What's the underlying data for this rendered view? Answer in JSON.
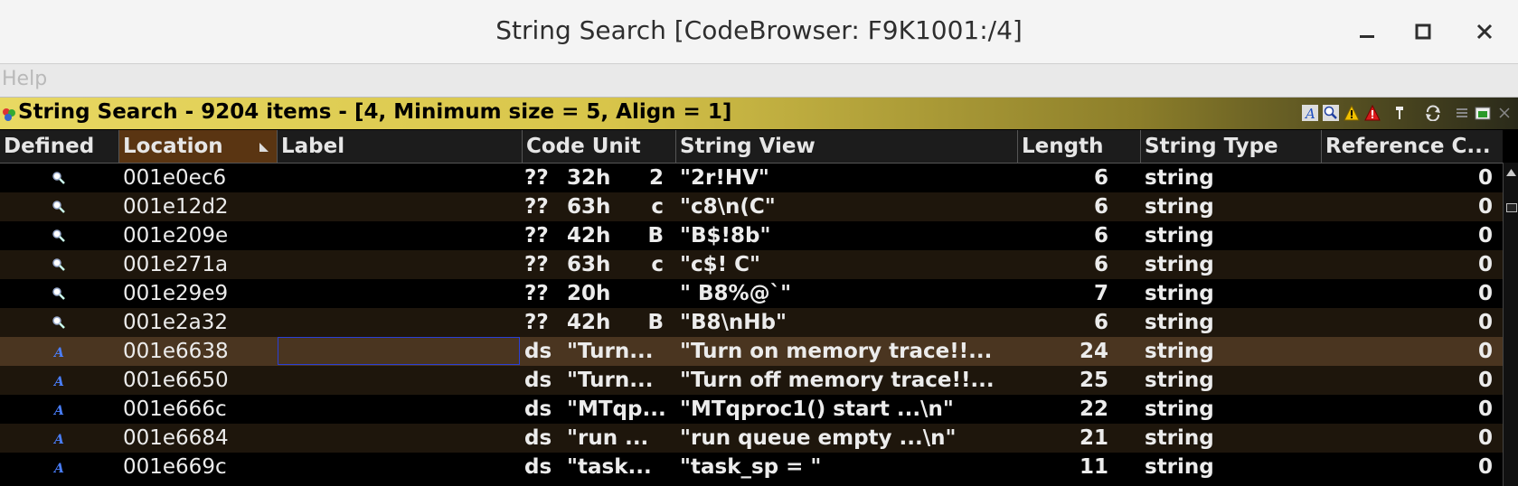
{
  "window": {
    "title": "String Search [CodeBrowser: F9K1001:/4]"
  },
  "menu": {
    "help": "Help"
  },
  "panel": {
    "title": "String Search - 9204 items - [4, Minimum size = 5, Align = 1]"
  },
  "columns": {
    "defined": "Defined",
    "location": "Location",
    "label": "Label",
    "code_unit": "Code Unit",
    "string_view": "String View",
    "length": "Length",
    "string_type": "String Type",
    "reference_count": "Reference C..."
  },
  "rows": [
    {
      "defined_icon": "magnifier-icon",
      "location": "001e0ec6",
      "label": "",
      "cu_mnemonic": "??",
      "cu_operand": "32h",
      "cu_char": "2",
      "string_view": "\"2r!HV\"",
      "length": "6",
      "string_type": "string",
      "refs": "0"
    },
    {
      "defined_icon": "magnifier-icon",
      "location": "001e12d2",
      "label": "",
      "cu_mnemonic": "??",
      "cu_operand": "63h",
      "cu_char": "c",
      "string_view": "\"c8\\n(C\"",
      "length": "6",
      "string_type": "string",
      "refs": "0"
    },
    {
      "defined_icon": "magnifier-icon",
      "location": "001e209e",
      "label": "",
      "cu_mnemonic": "??",
      "cu_operand": "42h",
      "cu_char": "B",
      "string_view": "\"B$!8b\"",
      "length": "6",
      "string_type": "string",
      "refs": "0"
    },
    {
      "defined_icon": "magnifier-icon",
      "location": "001e271a",
      "label": "",
      "cu_mnemonic": "??",
      "cu_operand": "63h",
      "cu_char": "c",
      "string_view": "\"c$! C\"",
      "length": "6",
      "string_type": "string",
      "refs": "0"
    },
    {
      "defined_icon": "magnifier-icon",
      "location": "001e29e9",
      "label": "",
      "cu_mnemonic": "??",
      "cu_operand": "20h",
      "cu_char": "",
      "string_view": "\" B8%@`\"",
      "length": "7",
      "string_type": "string",
      "refs": "0"
    },
    {
      "defined_icon": "magnifier-icon",
      "location": "001e2a32",
      "label": "",
      "cu_mnemonic": "??",
      "cu_operand": "42h",
      "cu_char": "B",
      "string_view": "\"B8\\nHb\"",
      "length": "6",
      "string_type": "string",
      "refs": "0"
    },
    {
      "defined_icon": "defined-string-icon",
      "location": "001e6638",
      "label": "",
      "cu_mnemonic": "ds",
      "cu_operand": "\"Turn...",
      "cu_char": "",
      "string_view": "\"Turn on memory trace!!...",
      "length": "24",
      "string_type": "string",
      "refs": "0",
      "selected": true
    },
    {
      "defined_icon": "defined-string-icon",
      "location": "001e6650",
      "label": "",
      "cu_mnemonic": "ds",
      "cu_operand": "\"Turn...",
      "cu_char": "",
      "string_view": "\"Turn off memory trace!!...",
      "length": "25",
      "string_type": "string",
      "refs": "0"
    },
    {
      "defined_icon": "defined-string-icon",
      "location": "001e666c",
      "label": "",
      "cu_mnemonic": "ds",
      "cu_operand": "\"MTqp...",
      "cu_char": "",
      "string_view": "\"MTqproc1() start ...\\n\"",
      "length": "22",
      "string_type": "string",
      "refs": "0"
    },
    {
      "defined_icon": "defined-string-icon",
      "location": "001e6684",
      "label": "",
      "cu_mnemonic": "ds",
      "cu_operand": "\"run ...",
      "cu_char": "",
      "string_view": "\"run queue empty ...\\n\"",
      "length": "21",
      "string_type": "string",
      "refs": "0"
    },
    {
      "defined_icon": "defined-string-icon",
      "location": "001e669c",
      "label": "",
      "cu_mnemonic": "ds",
      "cu_operand": "\"task...",
      "cu_char": "",
      "string_view": "\"task_sp = \"",
      "length": "11",
      "string_type": "string",
      "refs": "0"
    }
  ],
  "colors": {
    "header_gradient_start": "#e8d862",
    "selected_row": "#4a3520",
    "sorted_column": "#5a3512",
    "alt_row": "#1e160c"
  }
}
